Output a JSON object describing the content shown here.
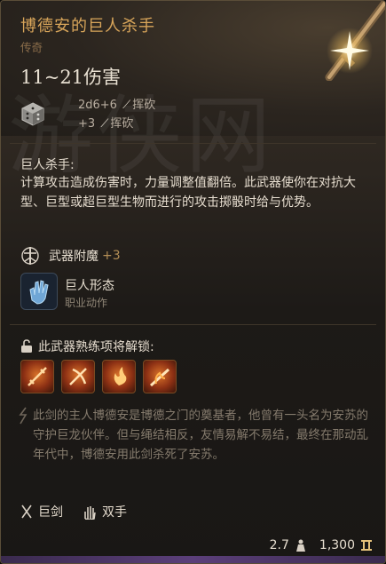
{
  "item": {
    "name": "博德安的巨人杀手",
    "rarity": "传奇",
    "damage_range": "11~21伤害",
    "damage_lines": [
      {
        "dice": "2d6+6",
        "type": "挥砍"
      },
      {
        "dice": "+3",
        "type": "挥砍"
      }
    ]
  },
  "watermark": "游侠网",
  "ability": {
    "title": "巨人杀手:",
    "description": "计算攻击造成伤害时，力量调整值翻倍。此武器使你在对抗大型、巨型或超巨型生物而进行的攻击掷骰时给与优势。"
  },
  "enchant": {
    "label": "武器附魔",
    "value": "+3"
  },
  "action": {
    "name": "巨人形态",
    "subtitle": "职业动作"
  },
  "proficiency": {
    "label": "此武器熟练项将解锁:",
    "icons": [
      "slash-skill-icon",
      "cleave-skill-icon",
      "fire-strike-icon",
      "flame-skill-icon"
    ]
  },
  "lore": "此剑的主人博德安是博德之门的奠基者，他曾有一头名为安苏的守护巨龙伙伴。但与绳结相反，友情易解不易结，最终在那动乱年代中，博德安用此剑杀死了安苏。",
  "tags": [
    {
      "icon": "greatsword-icon",
      "label": "巨剑"
    },
    {
      "icon": "two-handed-icon",
      "label": "双手"
    }
  ],
  "footer": {
    "weight": "2.7",
    "value": "1,300"
  },
  "colors": {
    "title": "#d8a55a",
    "rarity": "#8b6d4a",
    "text": "#e6ddcf",
    "lore": "#847a6c",
    "accent": "#b48f56"
  }
}
